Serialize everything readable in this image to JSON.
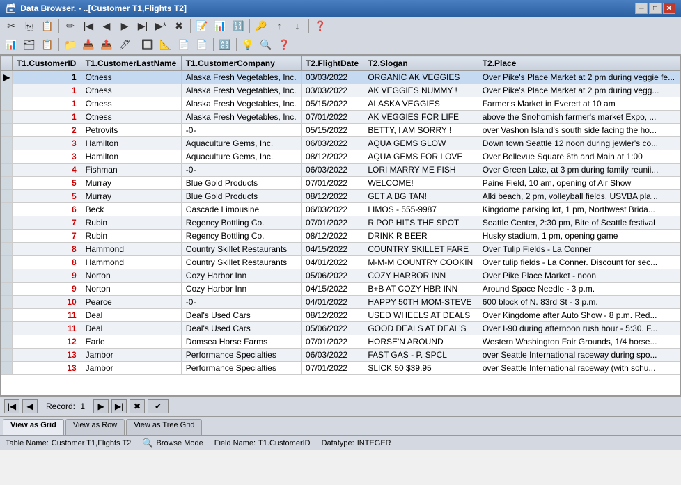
{
  "window": {
    "title": "Data Browser. - ..[Customer T1,Flights T2]"
  },
  "titlebar": {
    "minimize_label": "─",
    "maximize_label": "□",
    "close_label": "✕"
  },
  "toolbar1": {
    "buttons": [
      "✂",
      "📋",
      "📄",
      "💾",
      "✏️",
      "↩",
      "➡",
      "⬅",
      "➡",
      "➡",
      "❌",
      "📝",
      "📊",
      "🔢",
      "🔑",
      "📁",
      "📥",
      "📤",
      "🔍",
      "🔎",
      "❓"
    ]
  },
  "toolbar2": {
    "buttons": [
      "📊",
      "🗂",
      "📋",
      "🖊",
      "🔤",
      "🔍",
      "📐",
      "📄",
      "📄",
      "🔠",
      "💡",
      "🔎",
      "❓"
    ]
  },
  "columns": [
    "T1.CustomerID",
    "T1.CustomerLastName",
    "T1.CustomerCompany",
    "T2.FlightDate",
    "T2.Slogan",
    "T2.Place"
  ],
  "rows": [
    {
      "indicator": "▶",
      "id": "1",
      "lastname": "Otness",
      "company": "Alaska Fresh Vegetables, Inc.",
      "date": "03/03/2022",
      "slogan": "ORGANIC AK VEGGIES",
      "place": "Over Pike's Place Market at 2 pm during veggie fe...",
      "selected": true
    },
    {
      "indicator": "",
      "id": "1",
      "lastname": "Otness",
      "company": "Alaska Fresh Vegetables, Inc.",
      "date": "03/03/2022",
      "slogan": "AK VEGGIES NUMMY !",
      "place": "Over Pike's Place Market at 2 pm during vegg...",
      "selected": false
    },
    {
      "indicator": "",
      "id": "1",
      "lastname": "Otness",
      "company": "Alaska Fresh Vegetables, Inc.",
      "date": "05/15/2022",
      "slogan": "ALASKA VEGGIES",
      "place": "Farmer's Market in Everett at 10 am",
      "selected": false
    },
    {
      "indicator": "",
      "id": "1",
      "lastname": "Otness",
      "company": "Alaska Fresh Vegetables, Inc.",
      "date": "07/01/2022",
      "slogan": "AK VEGGIES FOR LIFE",
      "place": "above the Snohomish farmer's market Expo, ...",
      "selected": false
    },
    {
      "indicator": "",
      "id": "2",
      "lastname": "Petrovits",
      "company": "-0-",
      "date": "05/15/2022",
      "slogan": "BETTY, I AM SORRY !",
      "place": "over Vashon Island's south side facing the ho...",
      "selected": false
    },
    {
      "indicator": "",
      "id": "3",
      "lastname": "Hamilton",
      "company": "Aquaculture Gems, Inc.",
      "date": "06/03/2022",
      "slogan": "AQUA GEMS GLOW",
      "place": "Down town Seattle 12 noon during jewler's co...",
      "selected": false
    },
    {
      "indicator": "",
      "id": "3",
      "lastname": "Hamilton",
      "company": "Aquaculture Gems, Inc.",
      "date": "08/12/2022",
      "slogan": "AQUA GEMS FOR LOVE",
      "place": "Over Bellevue Square 6th and Main at 1:00",
      "selected": false
    },
    {
      "indicator": "",
      "id": "4",
      "lastname": "Fishman",
      "company": "-0-",
      "date": "06/03/2022",
      "slogan": "LORI MARRY ME FISH",
      "place": "Over Green Lake, at 3 pm during family reunii...",
      "selected": false
    },
    {
      "indicator": "",
      "id": "5",
      "lastname": "Murray",
      "company": "Blue Gold Products",
      "date": "07/01/2022",
      "slogan": "WELCOME!",
      "place": "Paine Field, 10 am, opening of Air Show",
      "selected": false
    },
    {
      "indicator": "",
      "id": "5",
      "lastname": "Murray",
      "company": "Blue Gold Products",
      "date": "08/12/2022",
      "slogan": "GET A BG TAN!",
      "place": "Alki beach, 2 pm, volleyball fields, USVBA pla...",
      "selected": false
    },
    {
      "indicator": "",
      "id": "6",
      "lastname": "Beck",
      "company": "Cascade Limousine",
      "date": "06/03/2022",
      "slogan": "LIMOS - 555-9987",
      "place": "Kingdome parking lot, 1 pm, Northwest Brida...",
      "selected": false
    },
    {
      "indicator": "",
      "id": "7",
      "lastname": "Rubin",
      "company": "Regency Bottling Co.",
      "date": "07/01/2022",
      "slogan": "R POP HITS THE SPOT",
      "place": "Seattle Center, 2:30 pm, Bite of Seattle festival",
      "selected": false
    },
    {
      "indicator": "",
      "id": "7",
      "lastname": "Rubin",
      "company": "Regency Bottling Co.",
      "date": "08/12/2022",
      "slogan": "DRINK R BEER",
      "place": "Husky stadium, 1 pm, opening game",
      "selected": false
    },
    {
      "indicator": "",
      "id": "8",
      "lastname": "Hammond",
      "company": "Country Skillet Restaurants",
      "date": "04/15/2022",
      "slogan": "COUNTRY SKILLET FARE",
      "place": "Over Tulip Fields - La Conner",
      "selected": false
    },
    {
      "indicator": "",
      "id": "8",
      "lastname": "Hammond",
      "company": "Country Skillet Restaurants",
      "date": "04/01/2022",
      "slogan": "M-M-M COUNTRY COOKIN",
      "place": "Over tulip fields - La Conner. Discount for sec...",
      "selected": false
    },
    {
      "indicator": "",
      "id": "9",
      "lastname": "Norton",
      "company": "Cozy Harbor Inn",
      "date": "05/06/2022",
      "slogan": "COZY HARBOR INN",
      "place": "Over Pike Place Market - noon",
      "selected": false
    },
    {
      "indicator": "",
      "id": "9",
      "lastname": "Norton",
      "company": "Cozy Harbor Inn",
      "date": "04/15/2022",
      "slogan": "B+B AT COZY HBR INN",
      "place": "Around Space Needle - 3 p.m.",
      "selected": false
    },
    {
      "indicator": "",
      "id": "10",
      "lastname": "Pearce",
      "company": "-0-",
      "date": "04/01/2022",
      "slogan": "HAPPY 50TH MOM-STEVE",
      "place": "600 block of N. 83rd St - 3 p.m.",
      "selected": false
    },
    {
      "indicator": "",
      "id": "11",
      "lastname": "Deal",
      "company": "Deal's Used Cars",
      "date": "08/12/2022",
      "slogan": "USED WHEELS AT DEALS",
      "place": "Over Kingdome after Auto Show - 8 p.m. Red...",
      "selected": false
    },
    {
      "indicator": "",
      "id": "11",
      "lastname": "Deal",
      "company": "Deal's Used Cars",
      "date": "05/06/2022",
      "slogan": "GOOD DEALS AT DEAL'S",
      "place": "Over I-90 during afternoon rush hour - 5:30. F...",
      "selected": false
    },
    {
      "indicator": "",
      "id": "12",
      "lastname": "Earle",
      "company": "Domsea Horse Farms",
      "date": "07/01/2022",
      "slogan": "HORSE'N AROUND",
      "place": "Western Washington Fair Grounds, 1/4 horse...",
      "selected": false
    },
    {
      "indicator": "",
      "id": "13",
      "lastname": "Jambor",
      "company": "Performance Specialties",
      "date": "06/03/2022",
      "slogan": "FAST GAS - P. SPCL",
      "place": "over Seattle International raceway during spo...",
      "selected": false
    },
    {
      "indicator": "",
      "id": "13",
      "lastname": "Jambor",
      "company": "Performance Specialties",
      "date": "07/01/2022",
      "slogan": "SLICK 50  $39.95",
      "place": "over Seattle International raceway (with schu...",
      "selected": false
    }
  ],
  "navigation": {
    "record_prefix": "Record:",
    "record_value": "1"
  },
  "tabs": [
    {
      "label": "View as Grid",
      "active": true
    },
    {
      "label": "View as Row",
      "active": false
    },
    {
      "label": "View as Tree Grid",
      "active": false
    }
  ],
  "statusbar": {
    "table_label": "Table Name:",
    "table_value": "Customer T1,Flights T2",
    "mode_label": "Browse Mode",
    "field_label": "Field Name:",
    "field_value": "T1.CustomerID",
    "datatype_label": "Datatype:",
    "datatype_value": "INTEGER"
  },
  "icons": {
    "db_icon": "🗃",
    "search_icon": "🔍",
    "gear_icon": "⚙",
    "magnifier_icon": "🔍"
  }
}
